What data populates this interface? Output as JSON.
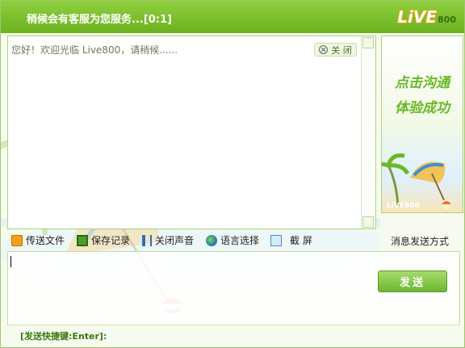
{
  "window": {
    "title": "稍候会有客服为您服务...[0:1]",
    "logo_text": "LiVE",
    "logo_number": "800"
  },
  "chat": {
    "welcome_message": "您好！欢迎光临  Live800，请稍候......",
    "close_label": "关 闭"
  },
  "ad": {
    "line1": "点击沟通",
    "line2": "体验成功",
    "brand": "LiVE800"
  },
  "toolbar": {
    "send_file": "传送文件",
    "save_record": "保存记录",
    "mute_sound": "关闭声音",
    "language": "语言选择",
    "screenshot": "截 屏",
    "send_mode": "消息发送方式"
  },
  "input": {
    "send_label": "发送",
    "shortcut_hint": "[发送快捷键:Enter]:"
  },
  "colors": {
    "accent_green": "#6bb21f",
    "border_green": "#9cc96a"
  },
  "icons": [
    "close-icon",
    "send-file-icon",
    "save-icon",
    "sound-icon",
    "globe-icon",
    "screenshot-icon"
  ]
}
